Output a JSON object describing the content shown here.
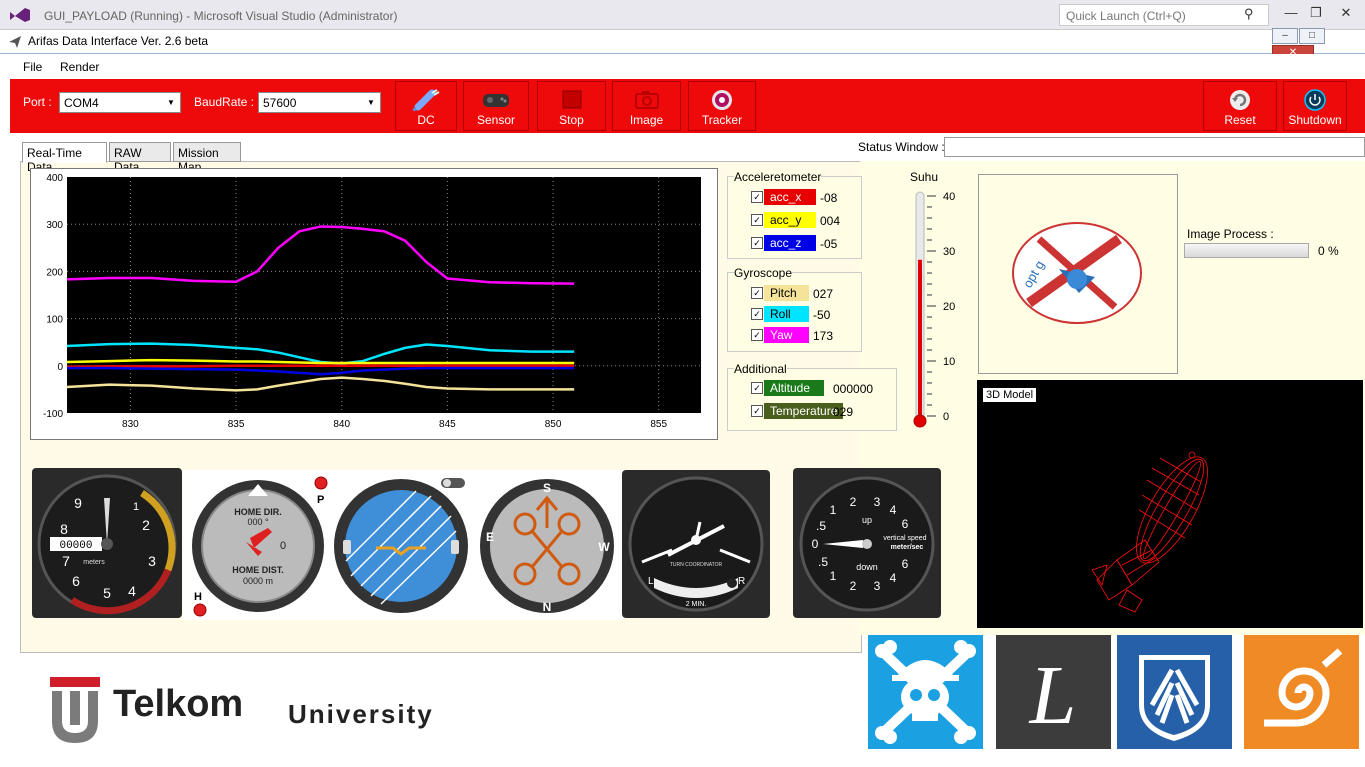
{
  "vs": {
    "title": "GUI_PAYLOAD (Running) - Microsoft Visual Studio (Administrator)",
    "quick_launch": "Quick Launch (Ctrl+Q)"
  },
  "app": {
    "title": "Arifas Data Interface Ver. 2.6 beta"
  },
  "menu": {
    "file": "File",
    "render": "Render"
  },
  "toolbar": {
    "port_label": "Port :",
    "port_value": "COM4",
    "baud_label": "BaudRate :",
    "baud_value": "57600",
    "dc": "DC",
    "sensor": "Sensor",
    "stop": "Stop",
    "image": "Image",
    "tracker": "Tracker",
    "reset": "Reset",
    "shutdown": "Shutdown"
  },
  "tabs": {
    "realtime": "Real-Time Data",
    "raw": "RAW Data",
    "map": "Mission Map"
  },
  "status": {
    "label": "Status Window :"
  },
  "accelerometer": {
    "title": "Acceleretometer",
    "items": [
      {
        "name": "acc_x",
        "value": "-08",
        "color": "#e60000"
      },
      {
        "name": "acc_y",
        "value": "004",
        "color": "#ffff00"
      },
      {
        "name": "acc_z",
        "value": "-05",
        "color": "#0000e6"
      }
    ]
  },
  "gyroscope": {
    "title": "Gyroscope",
    "items": [
      {
        "name": "Pitch",
        "value": "027",
        "color": "#f5e39a"
      },
      {
        "name": "Roll",
        "value": "-50",
        "color": "#00e5ff"
      },
      {
        "name": "Yaw",
        "value": "173",
        "color": "#ff00ff"
      }
    ]
  },
  "additional": {
    "title": "Additional",
    "items": [
      {
        "name": "Altitude",
        "value": "000000",
        "color": "#1a7a1a"
      },
      {
        "name": "Temperature",
        "value": "029",
        "color": "#4a5e1e"
      }
    ]
  },
  "thermometer": {
    "label": "Suhu",
    "ticks": [
      "40",
      "30",
      "20",
      "10",
      "0"
    ],
    "level": 0.71
  },
  "image_process": {
    "label": "Image Process :",
    "percent": "0 %"
  },
  "model3d": {
    "label": "3D Model"
  },
  "gauges": {
    "altimeter": {
      "unit": "meters",
      "counter": "00000"
    },
    "home": {
      "dir_label": "HOME DIR.",
      "dir_value": "000 °",
      "dist_label": "HOME DIST.",
      "dist_value": "0000 m",
      "p": "P",
      "h": "H",
      "zero": "0"
    },
    "heading": {
      "n": "N",
      "e": "E",
      "s": "S",
      "w": "W"
    },
    "turn": {
      "label": "TURN COORDINATOR",
      "l": "L",
      "r": "R",
      "min": "2 MIN."
    },
    "vsi": {
      "up": "up",
      "down": "down",
      "label": "vertical speed",
      "unit": "meter/sec"
    }
  },
  "university": {
    "name": "Telkom",
    "sub": "University"
  },
  "logo_text": "opt g",
  "chart_data": {
    "type": "line",
    "xlim": [
      827,
      857
    ],
    "ylim": [
      -100,
      400
    ],
    "xticks": [
      "830",
      "835",
      "840",
      "845",
      "850",
      "855"
    ],
    "yticks": [
      "400",
      "300",
      "200",
      "100",
      "0",
      "-100"
    ],
    "grid": true,
    "x": [
      827,
      829,
      831,
      833,
      835,
      836,
      837,
      838,
      839,
      840,
      841,
      842,
      843,
      844,
      845,
      847,
      849,
      851
    ],
    "series": [
      {
        "color": "#ff00ff",
        "values": [
          183,
          186,
          186,
          180,
          178,
          200,
          250,
          285,
          295,
          294,
          290,
          285,
          265,
          220,
          185,
          177,
          175,
          174
        ]
      },
      {
        "color": "#00e5ff",
        "values": [
          42,
          46,
          47,
          44,
          38,
          35,
          28,
          18,
          8,
          5,
          10,
          25,
          38,
          45,
          42,
          33,
          30,
          30
        ]
      },
      {
        "color": "#ffff00",
        "values": [
          8,
          10,
          12,
          11,
          9,
          9,
          8,
          7,
          6,
          6,
          6,
          6,
          6,
          6,
          6,
          6,
          6,
          6
        ]
      },
      {
        "color": "#e60000",
        "values": [
          -2,
          -1,
          -1,
          -1,
          0,
          0,
          0,
          0,
          0,
          0,
          0,
          0,
          0,
          0,
          0,
          0,
          0,
          0
        ]
      },
      {
        "color": "#0000e6",
        "values": [
          -5,
          -5,
          -6,
          -7,
          -8,
          -10,
          -12,
          -15,
          -18,
          -15,
          -10,
          -8,
          -6,
          -5,
          -5,
          -5,
          -5,
          -5
        ]
      },
      {
        "color": "#f5e39a",
        "values": [
          -45,
          -40,
          -42,
          -48,
          -52,
          -50,
          -42,
          -35,
          -28,
          -25,
          -28,
          -32,
          -38,
          -45,
          -48,
          -50,
          -50,
          -50
        ]
      }
    ]
  }
}
